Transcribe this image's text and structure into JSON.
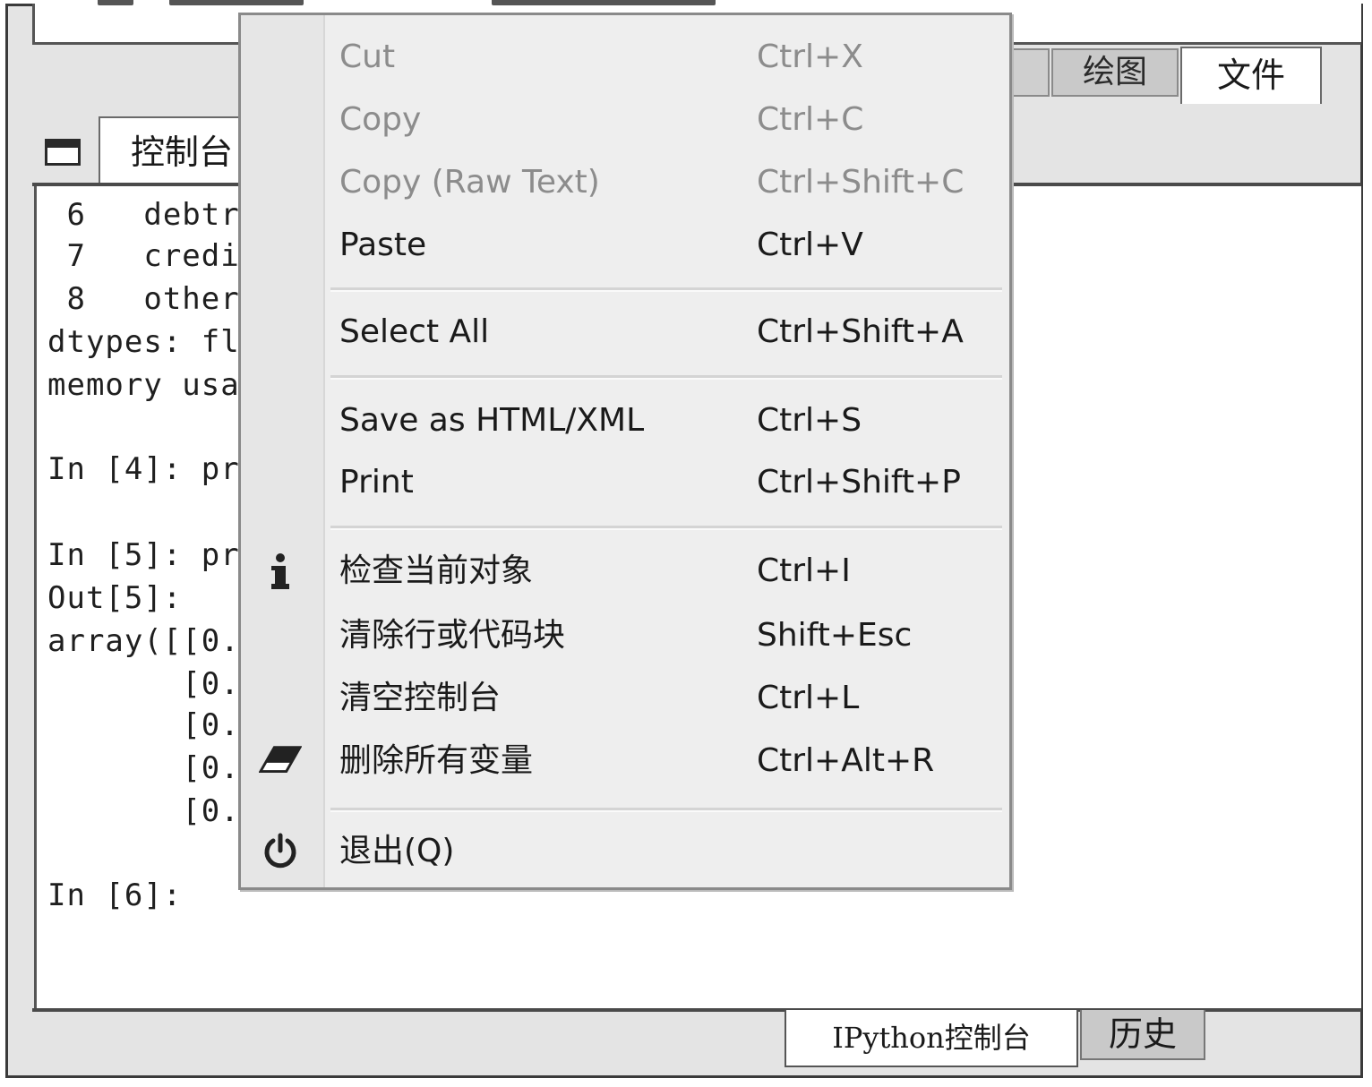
{
  "top_tabs": {
    "plots": "绘图",
    "files": "文件"
  },
  "console_tab": {
    "label": "控制台"
  },
  "console_lines": [
    " 6   debtr",
    " 7   credi",
    " 8   other",
    "dtypes: fl",
    "memory usa",
    "",
    "In [4]: pr",
    "",
    "In [5]: pr",
    "Out[5]:",
    "array([[0.",
    "       [0.",
    "       [0.",
    "       [0.",
    "       [0.",
    "",
    "In [6]:"
  ],
  "context_menu": {
    "items": [
      {
        "label": "Cut",
        "shortcut": "Ctrl+X",
        "enabled": false,
        "icon": ""
      },
      {
        "label": "Copy",
        "shortcut": "Ctrl+C",
        "enabled": false,
        "icon": ""
      },
      {
        "label": "Copy (Raw Text)",
        "shortcut": "Ctrl+Shift+C",
        "enabled": false,
        "icon": ""
      },
      {
        "label": "Paste",
        "shortcut": "Ctrl+V",
        "enabled": true,
        "icon": ""
      },
      {
        "label": "Select All",
        "shortcut": "Ctrl+Shift+A",
        "enabled": true,
        "icon": ""
      },
      {
        "label": "Save as HTML/XML",
        "shortcut": "Ctrl+S",
        "enabled": true,
        "icon": ""
      },
      {
        "label": "Print",
        "shortcut": "Ctrl+Shift+P",
        "enabled": true,
        "icon": ""
      },
      {
        "label": "检查当前对象",
        "shortcut": "Ctrl+I",
        "enabled": true,
        "icon": "info-icon"
      },
      {
        "label": "清除行或代码块",
        "shortcut": "Shift+Esc",
        "enabled": true,
        "icon": ""
      },
      {
        "label": "清空控制台",
        "shortcut": "Ctrl+L",
        "enabled": true,
        "icon": ""
      },
      {
        "label": "删除所有变量",
        "shortcut": "Ctrl+Alt+R",
        "enabled": true,
        "icon": "eraser-icon"
      },
      {
        "label": "退出(Q)",
        "shortcut": "",
        "enabled": true,
        "icon": "power-icon"
      }
    ]
  },
  "bottom_tabs": {
    "ipython_console": "IPython控制台",
    "history": "历史"
  }
}
